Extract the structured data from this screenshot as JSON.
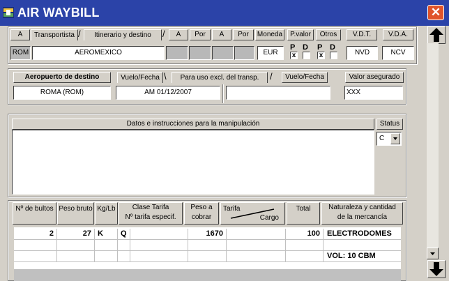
{
  "window": {
    "title": "AIR WAYBILL",
    "close_glyph": "✕"
  },
  "routing": {
    "btn_a1": "A",
    "tab_transportista": "Transportista",
    "tab_itinerario": "Itinerario y destino",
    "btn_a2": "A",
    "btn_por1": "Por",
    "btn_a3": "A",
    "btn_por2": "Por",
    "btn_moneda": "Moneda",
    "btn_pvalor": "P.valor",
    "btn_otros": "Otros",
    "btn_vdt": "V.D.T.",
    "btn_vda": "V.D.A.",
    "origin": "ROM",
    "carrier": "AEROMEXICO",
    "currency": "EUR",
    "pvalor_p": "P",
    "pvalor_d": "D",
    "otros_p": "P",
    "otros_d": "D",
    "pvalor_p_checked": true,
    "pvalor_d_checked": false,
    "otros_p_checked": true,
    "otros_d_checked": false,
    "check_mark": "x",
    "vdt_value": "NVD",
    "vda_value": "NCV"
  },
  "destination": {
    "btn_aeropuerto": "Aeropuerto de destino",
    "tab_vuelo1": "Vuelo/Fecha",
    "tab_uso": "Para uso excl. del transp.",
    "tab_vuelo2": "Vuelo/Fecha",
    "btn_valor_asegurado": "Valor asegurado",
    "airport_value": "ROMA (ROM)",
    "flight_value": "AM  01/12/2007",
    "carrier_use_value": "",
    "flight2_value": "",
    "insured_value": "XXX"
  },
  "handling": {
    "label": "Datos e instrucciones para la manipulación",
    "text": "",
    "status_label": "Status",
    "status_value": "C"
  },
  "goods": {
    "headers": {
      "bultos": "Nº de bultos",
      "peso_bruto": "Peso bruto",
      "kg_lb": "Kg/Lb",
      "clase_tarifa_1": "Clase Tarifa",
      "clase_tarifa_2": "Nº tarifa especif.",
      "peso_cobrar_1": "Peso a",
      "peso_cobrar_2": "cobrar",
      "tarifa": "Tarifa",
      "cargo": "Cargo",
      "total": "Total",
      "naturaleza_1": "Naturaleza y cantidad",
      "naturaleza_2": "de la mercancía"
    },
    "rows": [
      {
        "bultos": "2",
        "peso_bruto": "27",
        "kg_lb": "K",
        "clase": "Q",
        "tarifa_n": "",
        "peso_cobrar": "1670",
        "tarifa_cargo": "",
        "total": "100",
        "naturaleza": "ELECTRODOMES"
      },
      {
        "bultos": "",
        "peso_bruto": "",
        "kg_lb": "",
        "clase": "",
        "tarifa_n": "",
        "peso_cobrar": "",
        "tarifa_cargo": "",
        "total": "",
        "naturaleza": ""
      },
      {
        "bultos": "",
        "peso_bruto": "",
        "kg_lb": "",
        "clase": "",
        "tarifa_n": "",
        "peso_cobrar": "",
        "tarifa_cargo": "",
        "total": "",
        "naturaleza": "VOL: 10 CBM"
      }
    ]
  },
  "icons": {
    "app": "waybill-app-icon",
    "close": "close-icon",
    "up": "scroll-up-icon",
    "down": "scroll-down-icon",
    "status_dropdown": "chevron-down-icon"
  }
}
